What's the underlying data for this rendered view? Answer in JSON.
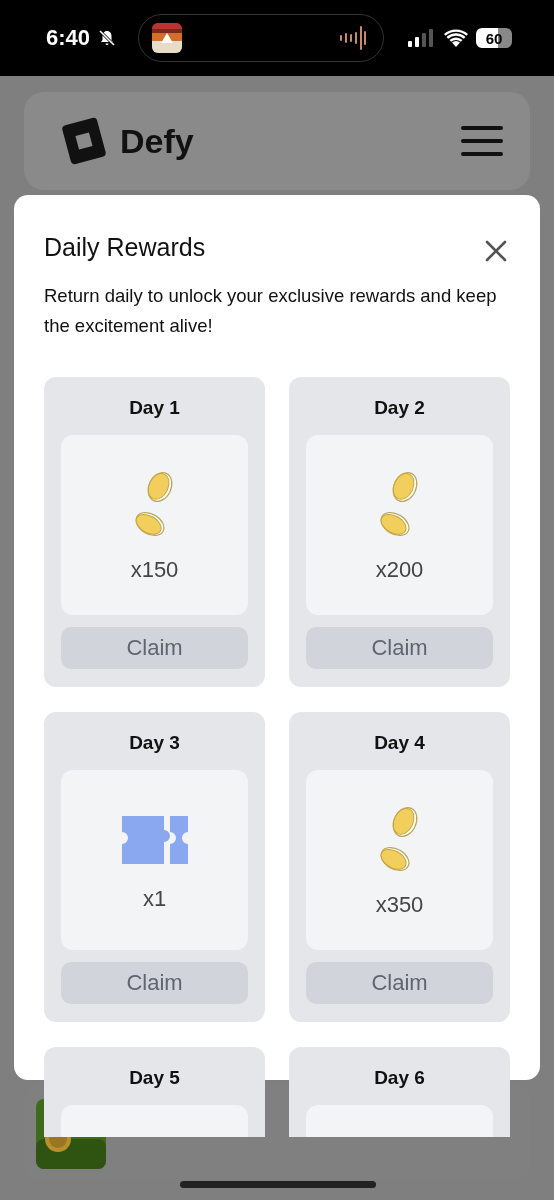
{
  "status_bar": {
    "time": "6:40",
    "battery": "60"
  },
  "header": {
    "brand": "Defy"
  },
  "modal": {
    "title": "Daily Rewards",
    "description": "Return daily to unlock your exclusive rewards and keep the excitement alive!",
    "days": [
      {
        "label": "Day 1",
        "kind": "coins",
        "amount": "x150",
        "claim": "Claim",
        "disabled": true
      },
      {
        "label": "Day 2",
        "kind": "coins",
        "amount": "x200",
        "claim": "Claim",
        "disabled": true
      },
      {
        "label": "Day 3",
        "kind": "ticket",
        "amount": "x1",
        "claim": "Claim",
        "disabled": true
      },
      {
        "label": "Day 4",
        "kind": "coins",
        "amount": "x350",
        "claim": "Claim",
        "disabled": true
      },
      {
        "label": "Day 5"
      },
      {
        "label": "Day 6"
      }
    ]
  }
}
